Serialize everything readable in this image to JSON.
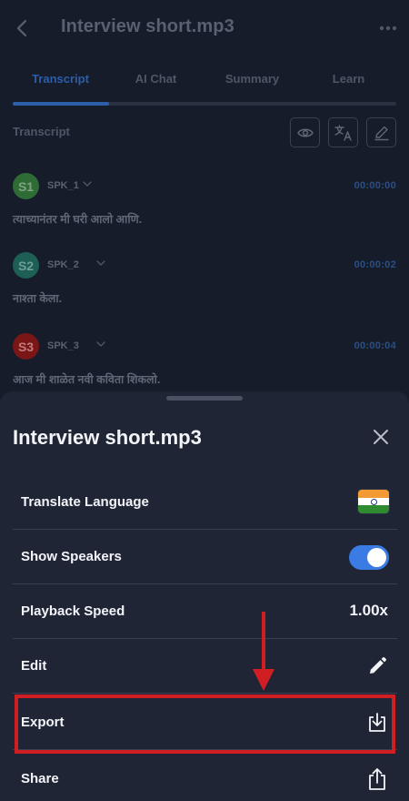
{
  "header": {
    "title": "Interview short.mp3"
  },
  "tabs": [
    {
      "label": "Transcript",
      "active": true
    },
    {
      "label": "AI Chat",
      "active": false
    },
    {
      "label": "Summary",
      "active": false
    },
    {
      "label": "Learn",
      "active": false
    }
  ],
  "transcript": {
    "section_label": "Transcript",
    "tools": [
      "eye-icon",
      "translate-icon",
      "pencil-icon"
    ],
    "segments": [
      {
        "avatar": "S1",
        "speaker": "SPK_1",
        "time": "00:00:00",
        "text": "त्याच्यानंतर मी घरी आलो आणि.",
        "color": "#2f6b35"
      },
      {
        "avatar": "S2",
        "speaker": "SPK_2",
        "time": "00:00:02",
        "text": "नाश्ता केला.",
        "color": "#1d5f55"
      },
      {
        "avatar": "S3",
        "speaker": "SPK_3",
        "time": "00:00:04",
        "text": "आज मी शाळेत नवी कविता शिकलो.",
        "color": "#7b1616"
      }
    ]
  },
  "sheet": {
    "title": "Interview short.mp3",
    "rows": {
      "translate": {
        "label": "Translate Language",
        "icon": "india-flag-icon"
      },
      "speakers": {
        "label": "Show Speakers",
        "enabled": true
      },
      "speed": {
        "label": "Playback Speed",
        "value": "1.00x"
      },
      "edit": {
        "label": "Edit",
        "icon": "pencil-icon"
      },
      "export": {
        "label": "Export",
        "icon": "download-icon"
      },
      "share": {
        "label": "Share",
        "icon": "share-icon"
      }
    }
  },
  "colors": {
    "accent": "#3a7be4",
    "annotation": "#d01e23",
    "sheet_bg": "#1f2535",
    "screen_bg": "#161c2a"
  }
}
